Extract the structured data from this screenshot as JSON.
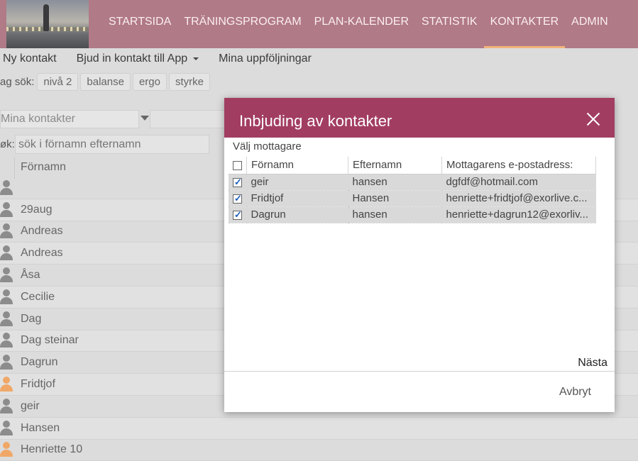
{
  "header": {
    "nav": [
      {
        "label": "STARTSIDA"
      },
      {
        "label": "TRÄNINGSPROGRAM"
      },
      {
        "label": "PLAN-KALENDER"
      },
      {
        "label": "STATISTIK"
      },
      {
        "label": "KONTAKTER",
        "active": true
      },
      {
        "label": "ADMIN"
      }
    ]
  },
  "toolbar": {
    "new_contact": "Ny kontakt",
    "invite_app": "Bjud in kontakt till App",
    "followups": "Mina uppföljningar"
  },
  "tags": {
    "label": "ag sök:",
    "items": [
      "nivå 2",
      "balanse",
      "ergo",
      "styrke"
    ]
  },
  "filter": {
    "selected": "Mina kontakter"
  },
  "search": {
    "label": "øk:",
    "placeholder": "sök i förnamn efternamn"
  },
  "list": {
    "column_header": "Förnamn",
    "rows": [
      {
        "name": "",
        "icon_color": "#8c8c8c"
      },
      {
        "name": "29aug",
        "icon_color": "#8c8c8c"
      },
      {
        "name": "Andreas",
        "icon_color": "#8c8c8c"
      },
      {
        "name": "Andreas",
        "icon_color": "#8c8c8c"
      },
      {
        "name": "Åsa",
        "icon_color": "#8c8c8c"
      },
      {
        "name": "Cecilie",
        "icon_color": "#8c8c8c"
      },
      {
        "name": "Dag",
        "icon_color": "#8c8c8c"
      },
      {
        "name": "Dag steinar",
        "icon_color": "#8c8c8c"
      },
      {
        "name": "Dagrun",
        "icon_color": "#8c8c8c"
      },
      {
        "name": "Fridtjof",
        "icon_color": "#f0a868"
      },
      {
        "name": "geir",
        "icon_color": "#8c8c8c"
      },
      {
        "name": "Hansen",
        "icon_color": "#8c8c8c"
      },
      {
        "name": "Henriette 10",
        "icon_color": "#f0a868"
      }
    ]
  },
  "modal": {
    "title": "Inbjuding av kontakter",
    "subtitle": "Välj mottagare",
    "columns": [
      "Förnamn",
      "Efternamn",
      "Mottagarens e-postadress:"
    ],
    "rows": [
      {
        "first": "geir",
        "last": "hansen",
        "email": "dgfdf@hotmail.com",
        "checked": true
      },
      {
        "first": "Fridtjof",
        "last": "Hansen",
        "email": "henriette+fridtjof@exorlive.c...",
        "checked": true
      },
      {
        "first": "Dagrun",
        "last": "hansen",
        "email": "henriette+dagrun12@exorliv...",
        "checked": true
      }
    ],
    "next_label": "Nästa",
    "cancel_label": "Avbryt"
  },
  "colors": {
    "header": "#b07a86",
    "modal_header": "#a23d62",
    "active_underline": "#f1b47a"
  }
}
